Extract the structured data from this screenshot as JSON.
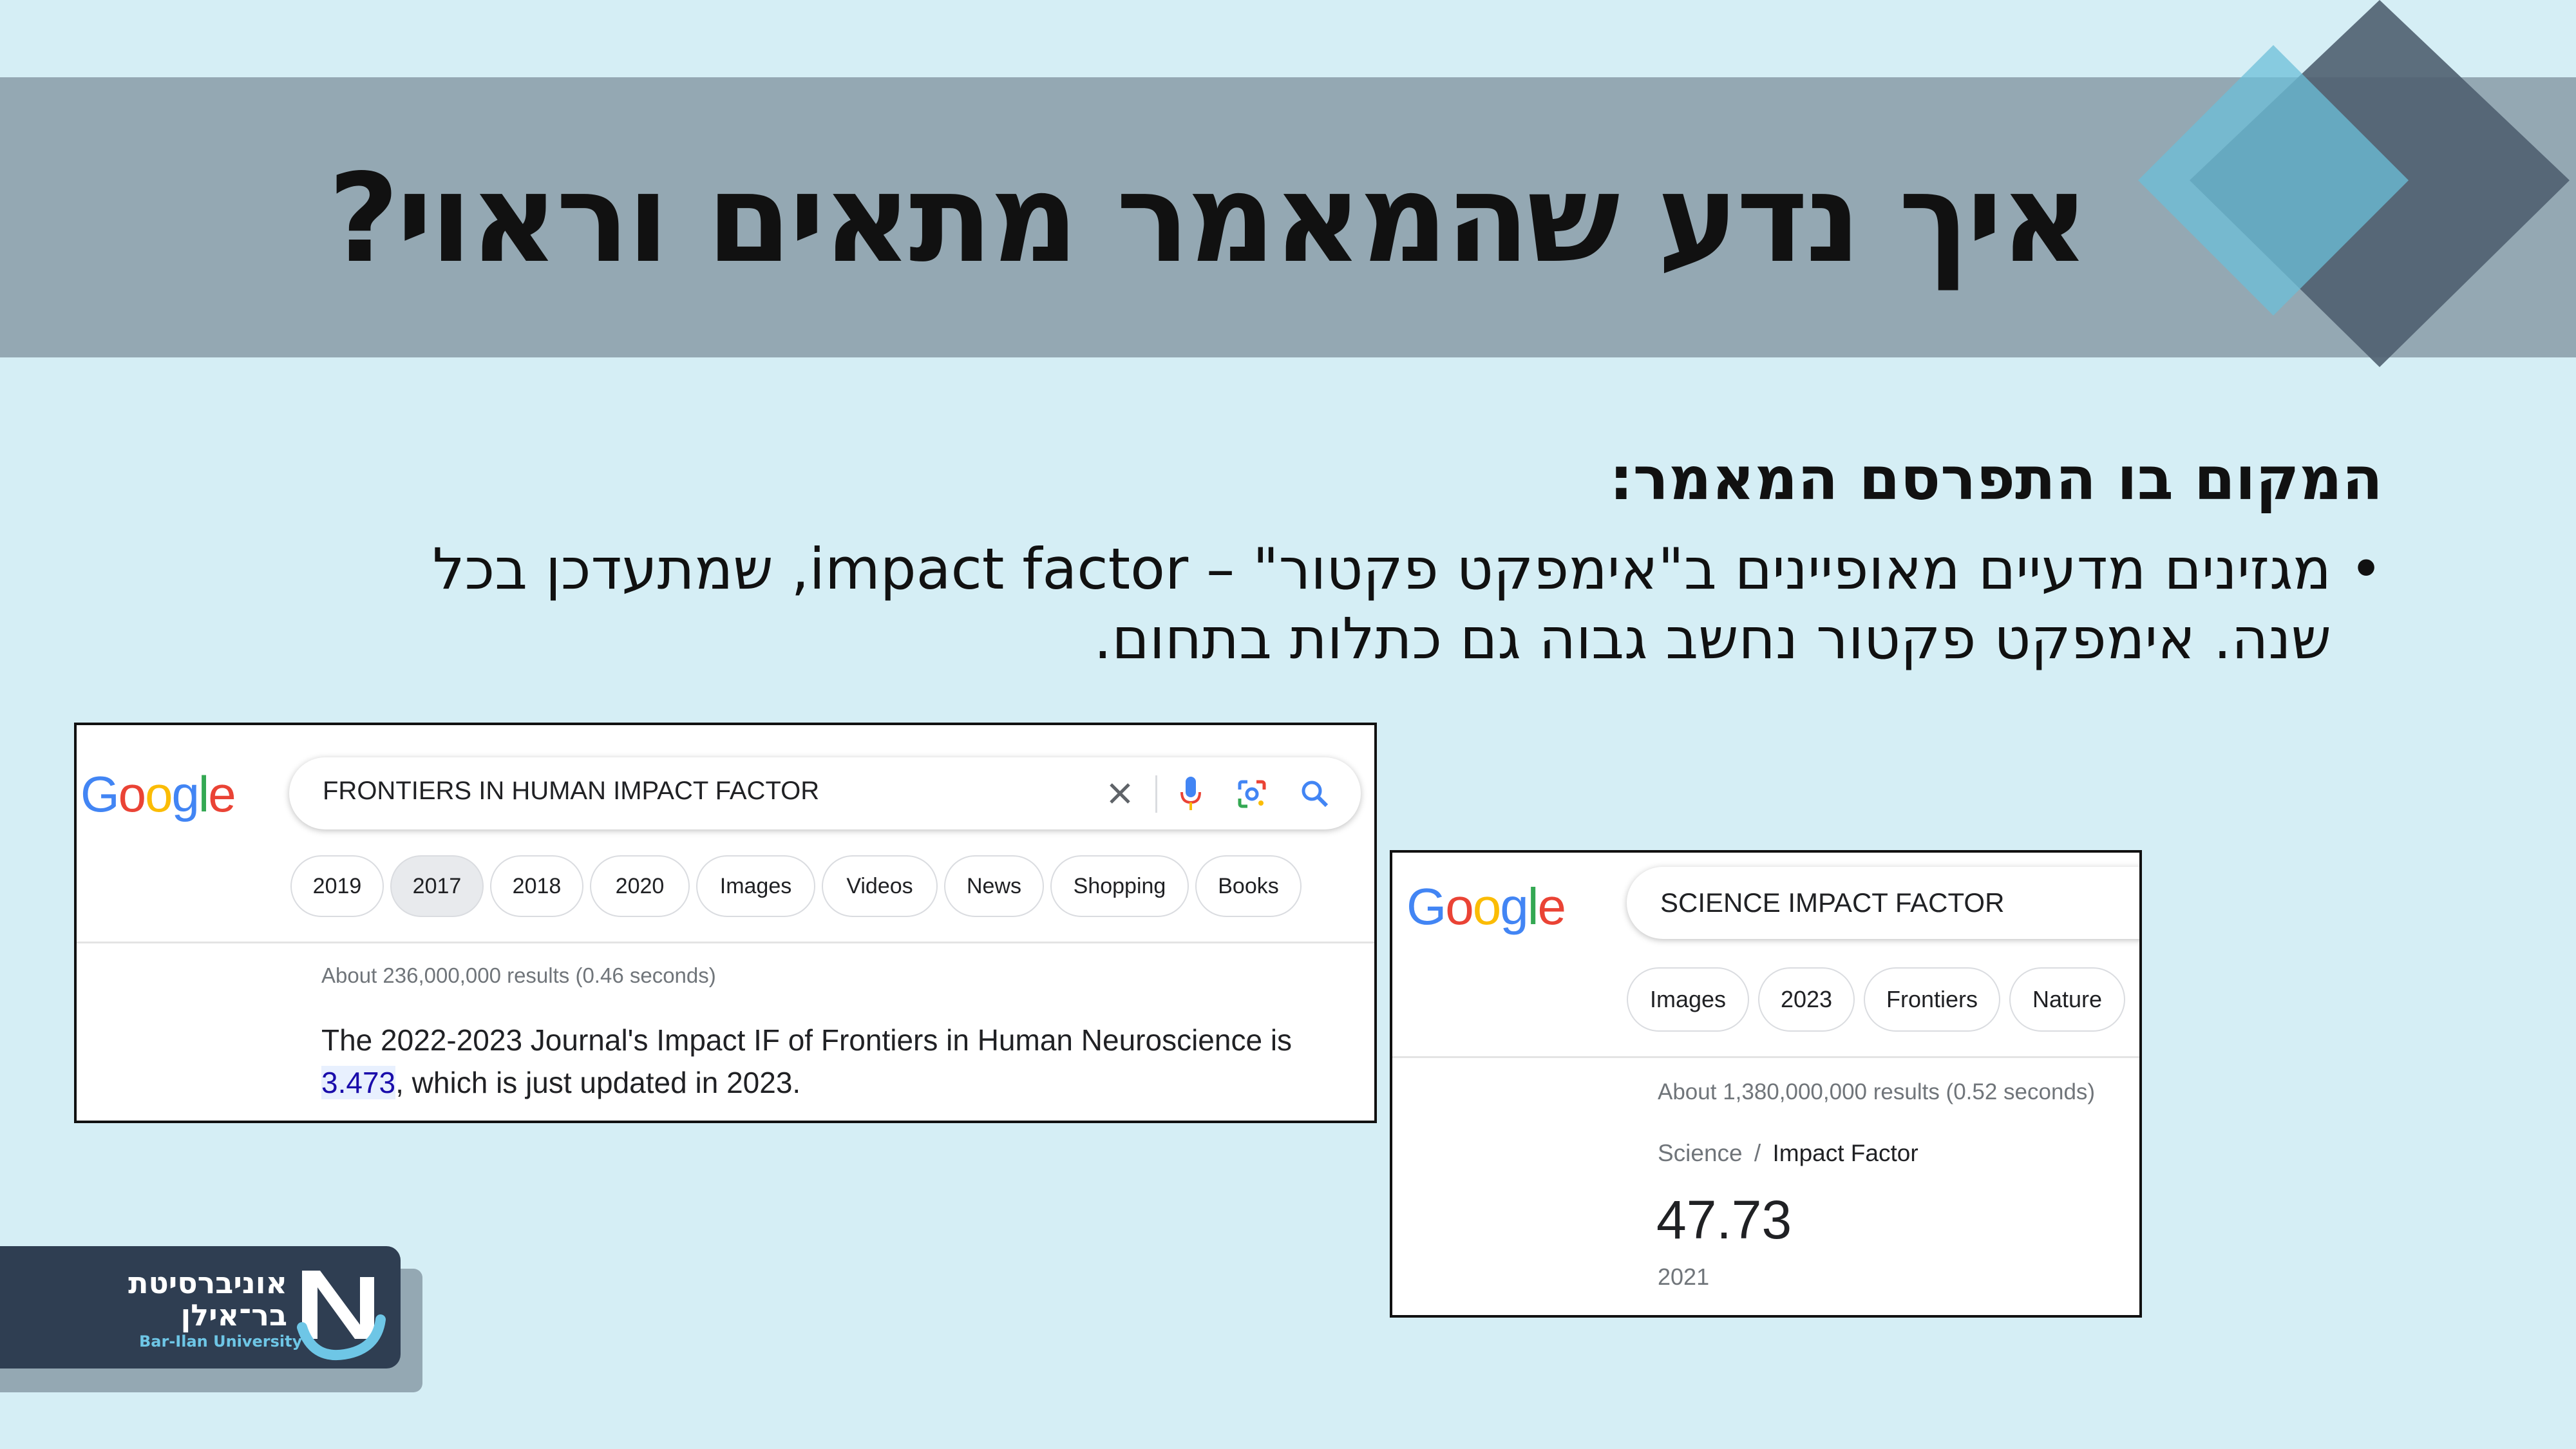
{
  "slide": {
    "title": "איך נדע שהמאמר מתאים וראוי?",
    "subheading": "המקום בו התפרסם המאמר:",
    "bullet_symbol": "•",
    "bullet_line1": "מגזינים מדעיים מאופיינים ב\"אימפקט פקטור\" – impact factor, שמתעדכן בכל",
    "bullet_line2": "שנה. אימפקט פקטור נחשב גבוה גם כתלות בתחום."
  },
  "colors": {
    "background": "#d5eef5",
    "banner": "#94a8b3",
    "diamond_dark": "#4f5f70",
    "diamond_light": "#6cbfd8",
    "logo_bg": "#2f3e52"
  },
  "search1": {
    "logo": "Google",
    "query": "FRONTIERS IN HUMAN IMPACT FACTOR",
    "chips": [
      "2019",
      "2017",
      "2018",
      "2020",
      "Images",
      "Videos",
      "News",
      "Shopping",
      "Books"
    ],
    "selected_chip": "2017",
    "results_meta": "About 236,000,000 results (0.46 seconds)",
    "snippet_line1": "The 2022-2023 Journal's Impact IF of Frontiers in Human Neuroscience is",
    "snippet_value": "3.473",
    "snippet_rest": ", which is just updated in 2023."
  },
  "search2": {
    "logo": "Google",
    "query": "SCIENCE IMPACT FACTOR",
    "chips": [
      "Images",
      "2023",
      "Frontiers",
      "Nature"
    ],
    "results_meta": "About 1,380,000,000 results (0.52 seconds)",
    "breadcrumb_root": "Science",
    "breadcrumb_sep": "/",
    "breadcrumb_leaf": "Impact Factor",
    "value": "47.73",
    "year": "2021"
  },
  "university_logo": {
    "hebrew_line1": "אוניברסיטת",
    "hebrew_line2": "בר־אילן",
    "english": "Bar-Ilan University"
  }
}
